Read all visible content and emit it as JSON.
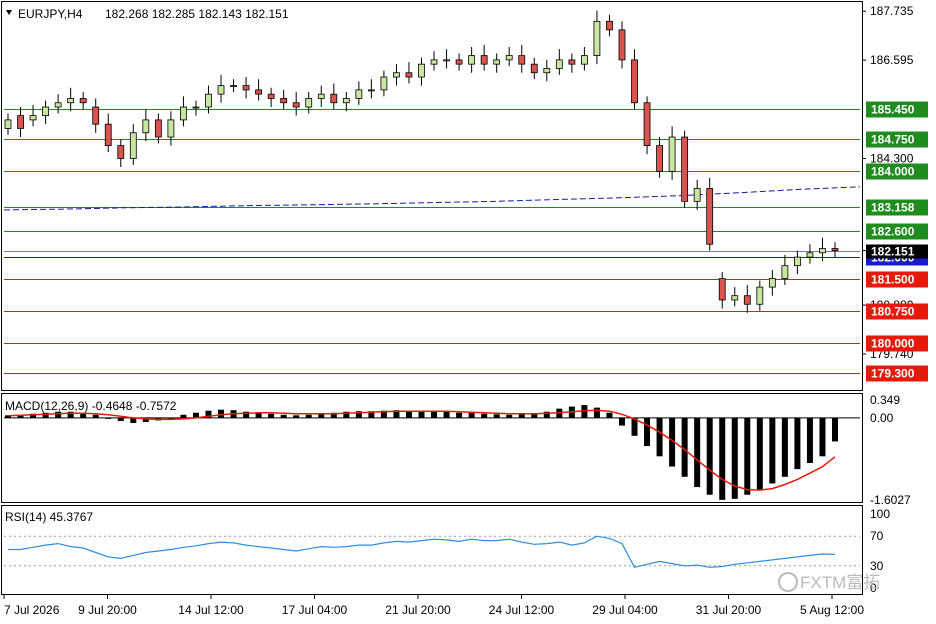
{
  "header": {
    "symbol": "EURJPY,H4",
    "ohlc": "182.268 182.285 182.143 182.151"
  },
  "watermark": "FXTM富拓",
  "colors": {
    "bull": "#c8e6a0",
    "bear": "#d9534f",
    "support": "#e8190a",
    "resistance": "#1e8c1e",
    "current": "#1a1ad0",
    "ma": "#1a1a9e",
    "signal": "#e8190a",
    "rsi": "#2e8fdc"
  },
  "chart_data": [
    {
      "type": "candlestick",
      "title": "EURJPY,H4",
      "ylim": [
        178.9,
        187.95
      ],
      "price_ticks": [
        "187.735",
        "186.595",
        "184.300",
        "182.151",
        "180.880",
        "179.740"
      ],
      "current_price": "182.151",
      "x_tick_labels": [
        "7 Jul 2026",
        "9 Jul 20:00",
        "14 Jul 12:00",
        "17 Jul 04:00",
        "21 Jul 20:00",
        "24 Jul 12:00",
        "29 Jul 04:00",
        "31 Jul 20:00",
        "5 Aug 12:00"
      ],
      "levels": [
        {
          "value": 185.45,
          "label": "185.450",
          "kind": "resistance"
        },
        {
          "value": 184.75,
          "label": "184.750",
          "kind": "resistance"
        },
        {
          "value": 184.0,
          "label": "184.000",
          "kind": "resistance"
        },
        {
          "value": 183.158,
          "label": "183.158",
          "kind": "resistance"
        },
        {
          "value": 182.6,
          "label": "182.600",
          "kind": "resistance"
        },
        {
          "value": 182.0,
          "label": "182.000",
          "kind": "current"
        },
        {
          "value": 181.5,
          "label": "181.500",
          "kind": "support"
        },
        {
          "value": 180.75,
          "label": "180.750",
          "kind": "support"
        },
        {
          "value": 180.0,
          "label": "180.000",
          "kind": "support"
        },
        {
          "value": 179.3,
          "label": "179.300",
          "kind": "support"
        }
      ],
      "moving_average": [
        183.1,
        183.12,
        183.15,
        183.17,
        183.2,
        183.22,
        183.24,
        183.27,
        183.3,
        183.34,
        183.38,
        183.43,
        183.5,
        183.58,
        183.64
      ],
      "closes": [
        185.2,
        185.0,
        185.3,
        185.5,
        185.6,
        185.7,
        185.6,
        185.1,
        184.6,
        184.3,
        184.9,
        185.2,
        184.8,
        185.2,
        185.5,
        185.5,
        185.8,
        186.0,
        186.0,
        185.9,
        185.8,
        185.7,
        185.6,
        185.5,
        185.7,
        185.8,
        185.6,
        185.7,
        185.9,
        185.9,
        186.2,
        186.3,
        186.2,
        186.5,
        186.6,
        186.6,
        186.5,
        186.7,
        186.5,
        186.6,
        186.7,
        186.5,
        186.3,
        186.4,
        186.6,
        186.5,
        186.7,
        187.5,
        187.3,
        186.6,
        185.6,
        184.6,
        184.0,
        184.8,
        183.3,
        183.6,
        182.3,
        181.0,
        181.1,
        180.9,
        181.3,
        181.5,
        181.8,
        182.0,
        182.1,
        182.2,
        182.15
      ],
      "opens": [
        185.0,
        185.3,
        185.2,
        185.3,
        185.5,
        185.6,
        185.7,
        185.5,
        185.1,
        184.6,
        184.3,
        184.9,
        185.2,
        184.8,
        185.2,
        185.5,
        185.5,
        185.8,
        186.0,
        186.0,
        185.9,
        185.8,
        185.7,
        185.6,
        185.5,
        185.7,
        185.8,
        185.6,
        185.7,
        185.9,
        185.9,
        186.2,
        186.3,
        186.2,
        186.5,
        186.6,
        186.6,
        186.5,
        186.7,
        186.5,
        186.6,
        186.7,
        186.5,
        186.3,
        186.4,
        186.6,
        186.5,
        186.7,
        187.5,
        187.3,
        186.6,
        185.6,
        184.6,
        184.0,
        184.8,
        183.3,
        183.6,
        181.5,
        181.0,
        181.1,
        180.9,
        181.3,
        181.5,
        181.8,
        182.0,
        182.1,
        182.2
      ],
      "series_name": "EURJPY H4"
    },
    {
      "type": "bar",
      "title": "MACD(12,26,9) -0.4648 -0.7572",
      "ylim": [
        -1.6027,
        0.349
      ],
      "y_tick_labels": [
        "0.349",
        "0.00",
        "-1.6027"
      ],
      "histogram": [
        0.05,
        0.06,
        0.08,
        0.1,
        0.12,
        0.12,
        0.1,
        0.06,
        0.0,
        -0.06,
        -0.1,
        -0.08,
        -0.05,
        0.0,
        0.06,
        0.1,
        0.14,
        0.16,
        0.15,
        0.12,
        0.1,
        0.08,
        0.06,
        0.05,
        0.06,
        0.08,
        0.1,
        0.12,
        0.13,
        0.13,
        0.14,
        0.15,
        0.14,
        0.13,
        0.13,
        0.12,
        0.1,
        0.1,
        0.08,
        0.07,
        0.06,
        0.07,
        0.08,
        0.12,
        0.18,
        0.22,
        0.25,
        0.2,
        0.1,
        -0.15,
        -0.35,
        -0.55,
        -0.75,
        -0.95,
        -1.15,
        -1.35,
        -1.5,
        -1.6,
        -1.58,
        -1.5,
        -1.4,
        -1.28,
        -1.15,
        -1.0,
        -0.88,
        -0.75,
        -0.46
      ],
      "signal": [
        0.04,
        0.05,
        0.06,
        0.07,
        0.08,
        0.09,
        0.09,
        0.08,
        0.06,
        0.03,
        0.0,
        -0.02,
        -0.03,
        -0.03,
        -0.02,
        0.0,
        0.03,
        0.06,
        0.08,
        0.09,
        0.1,
        0.1,
        0.09,
        0.08,
        0.08,
        0.08,
        0.08,
        0.09,
        0.1,
        0.11,
        0.12,
        0.13,
        0.13,
        0.13,
        0.13,
        0.13,
        0.12,
        0.11,
        0.1,
        0.09,
        0.08,
        0.08,
        0.08,
        0.09,
        0.1,
        0.12,
        0.14,
        0.15,
        0.13,
        0.07,
        -0.02,
        -0.14,
        -0.28,
        -0.44,
        -0.62,
        -0.82,
        -1.02,
        -1.2,
        -1.33,
        -1.4,
        -1.41,
        -1.38,
        -1.3,
        -1.2,
        -1.08,
        -0.95,
        -0.76
      ]
    },
    {
      "type": "line",
      "title": "RSI(14) 45.3767",
      "ylim": [
        0,
        100
      ],
      "y_tick_labels": [
        "100",
        "70",
        "30",
        "0"
      ],
      "values": [
        52,
        52,
        55,
        58,
        60,
        56,
        54,
        48,
        42,
        40,
        44,
        48,
        50,
        52,
        55,
        57,
        60,
        62,
        61,
        58,
        56,
        54,
        52,
        50,
        53,
        56,
        55,
        56,
        58,
        58,
        61,
        63,
        62,
        64,
        66,
        65,
        63,
        66,
        64,
        64,
        66,
        62,
        59,
        60,
        62,
        58,
        61,
        70,
        67,
        60,
        28,
        32,
        36,
        33,
        30,
        31,
        28,
        29,
        32,
        34,
        36,
        38,
        40,
        42,
        44,
        46,
        45.4
      ]
    }
  ]
}
